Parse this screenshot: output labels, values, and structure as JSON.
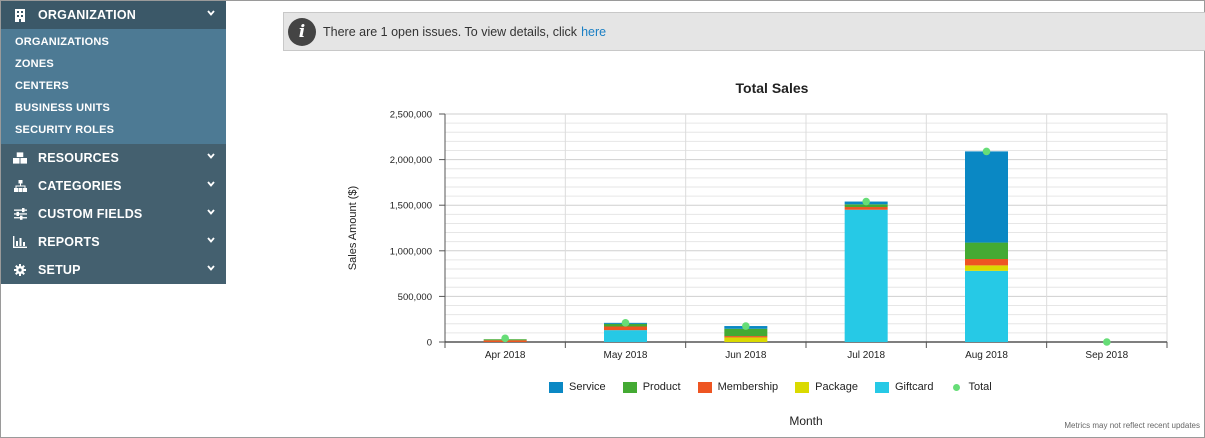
{
  "sidebar": {
    "sections": [
      {
        "label": "ORGANIZATION",
        "icon": "building-icon",
        "expanded": true,
        "items": [
          "ORGANIZATIONS",
          "ZONES",
          "CENTERS",
          "BUSINESS UNITS",
          "SECURITY ROLES"
        ]
      },
      {
        "label": "RESOURCES",
        "icon": "cubes-icon"
      },
      {
        "label": "CATEGORIES",
        "icon": "sitemap-icon"
      },
      {
        "label": "CUSTOM FIELDS",
        "icon": "sliders-icon"
      },
      {
        "label": "REPORTS",
        "icon": "bar-chart-icon"
      },
      {
        "label": "SETUP",
        "icon": "gear-icon"
      }
    ]
  },
  "alert": {
    "message": "There are 1 open issues. To view details, click",
    "link": "here"
  },
  "chart_data": {
    "type": "bar",
    "title": "Total Sales",
    "xlabel": "Month",
    "ylabel": "Sales Amount ($)",
    "ylim": [
      0,
      2500000
    ],
    "yticks": [
      "0",
      "500,000",
      "1,000,000",
      "1,500,000",
      "2,000,000",
      "2,500,000"
    ],
    "categories": [
      "Apr 2018",
      "May 2018",
      "Jun 2018",
      "Jul 2018",
      "Aug 2018",
      "Sep 2018"
    ],
    "series": [
      {
        "name": "Giftcard",
        "color": "#26c9e6",
        "values": [
          0,
          130000,
          0,
          1450000,
          780000,
          0
        ]
      },
      {
        "name": "Package",
        "color": "#dada00",
        "values": [
          0,
          0,
          50000,
          0,
          60000,
          0
        ]
      },
      {
        "name": "Membership",
        "color": "#ee5522",
        "values": [
          20000,
          40000,
          15000,
          30000,
          70000,
          0
        ]
      },
      {
        "name": "Product",
        "color": "#44aa33",
        "values": [
          10000,
          30000,
          80000,
          30000,
          180000,
          0
        ]
      },
      {
        "name": "Service",
        "color": "#0a88c4",
        "values": [
          0,
          10000,
          30000,
          30000,
          1000000,
          0
        ]
      }
    ],
    "total": {
      "name": "Total",
      "color": "#66dd77",
      "values": [
        40000,
        210000,
        175000,
        1540000,
        2090000,
        0
      ]
    },
    "grid": true,
    "legend_position": "bottom",
    "legend_order": [
      "Service",
      "Product",
      "Membership",
      "Package",
      "Giftcard",
      "Total"
    ]
  },
  "footnote": "Metrics may not reflect recent updates"
}
